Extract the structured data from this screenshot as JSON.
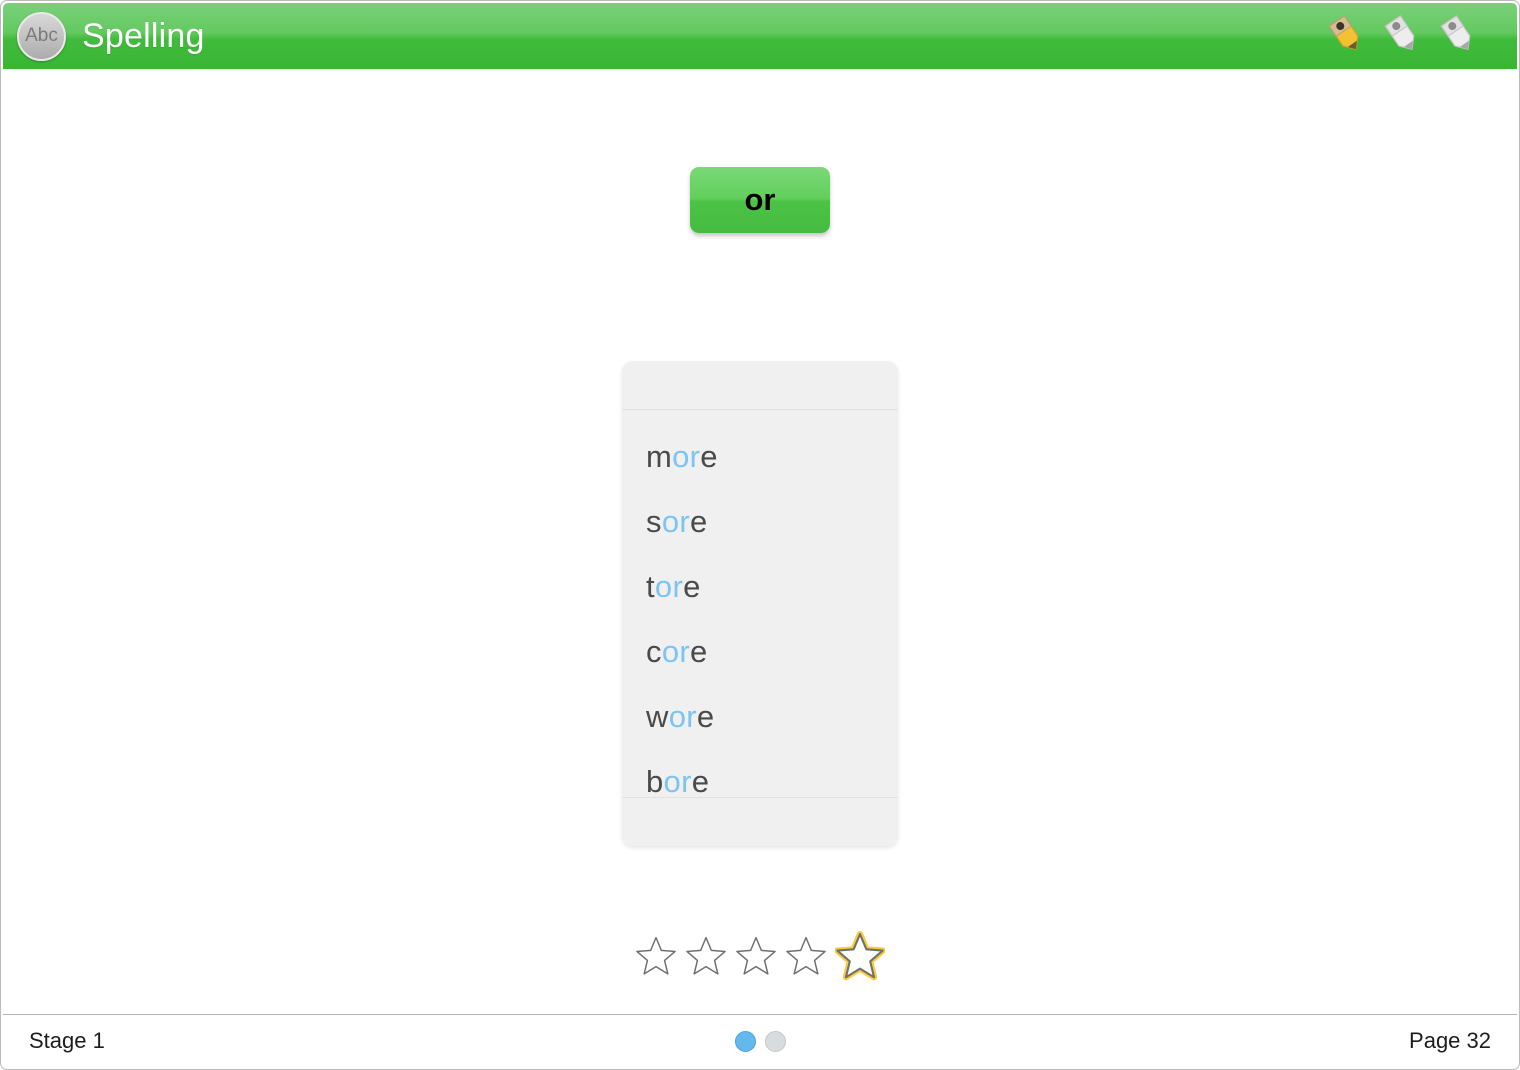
{
  "header": {
    "app_icon_label": "Abc",
    "app_icon_name": "abc-circle-icon",
    "title": "Spelling",
    "tools": [
      {
        "name": "pencil-tool-yellow",
        "label": "Pencil",
        "state": "active",
        "color": "#f2c234"
      },
      {
        "name": "pencil-tool-white-1",
        "label": "Pencil",
        "state": "inactive",
        "color": "#e6e6e6"
      },
      {
        "name": "pencil-tool-white-2",
        "label": "Pencil",
        "state": "inactive",
        "color": "#e6e6e6"
      }
    ]
  },
  "main": {
    "target_chunk": "or",
    "words": [
      {
        "prefix": "m",
        "highlight": "or",
        "suffix": "e"
      },
      {
        "prefix": "s",
        "highlight": "or",
        "suffix": "e"
      },
      {
        "prefix": "t",
        "highlight": "or",
        "suffix": "e"
      },
      {
        "prefix": "c",
        "highlight": "or",
        "suffix": "e"
      },
      {
        "prefix": "w",
        "highlight": "or",
        "suffix": "e"
      },
      {
        "prefix": "b",
        "highlight": "or",
        "suffix": "e"
      }
    ],
    "stars": {
      "total": 5,
      "highlighted_index": 5,
      "outline_color": "#6f6f6f",
      "highlight_color": "#fbcb3d"
    },
    "colors": {
      "highlight_text": "#7cc4f2",
      "word_text": "#4a4a4a",
      "accent_green": "#4cc247",
      "panel_bg": "#f0f0f0"
    }
  },
  "footer": {
    "stage_label": "Stage 1",
    "page_label": "Page 32",
    "dots": [
      {
        "name": "page-dot-1",
        "active": true
      },
      {
        "name": "page-dot-2",
        "active": false
      }
    ]
  }
}
